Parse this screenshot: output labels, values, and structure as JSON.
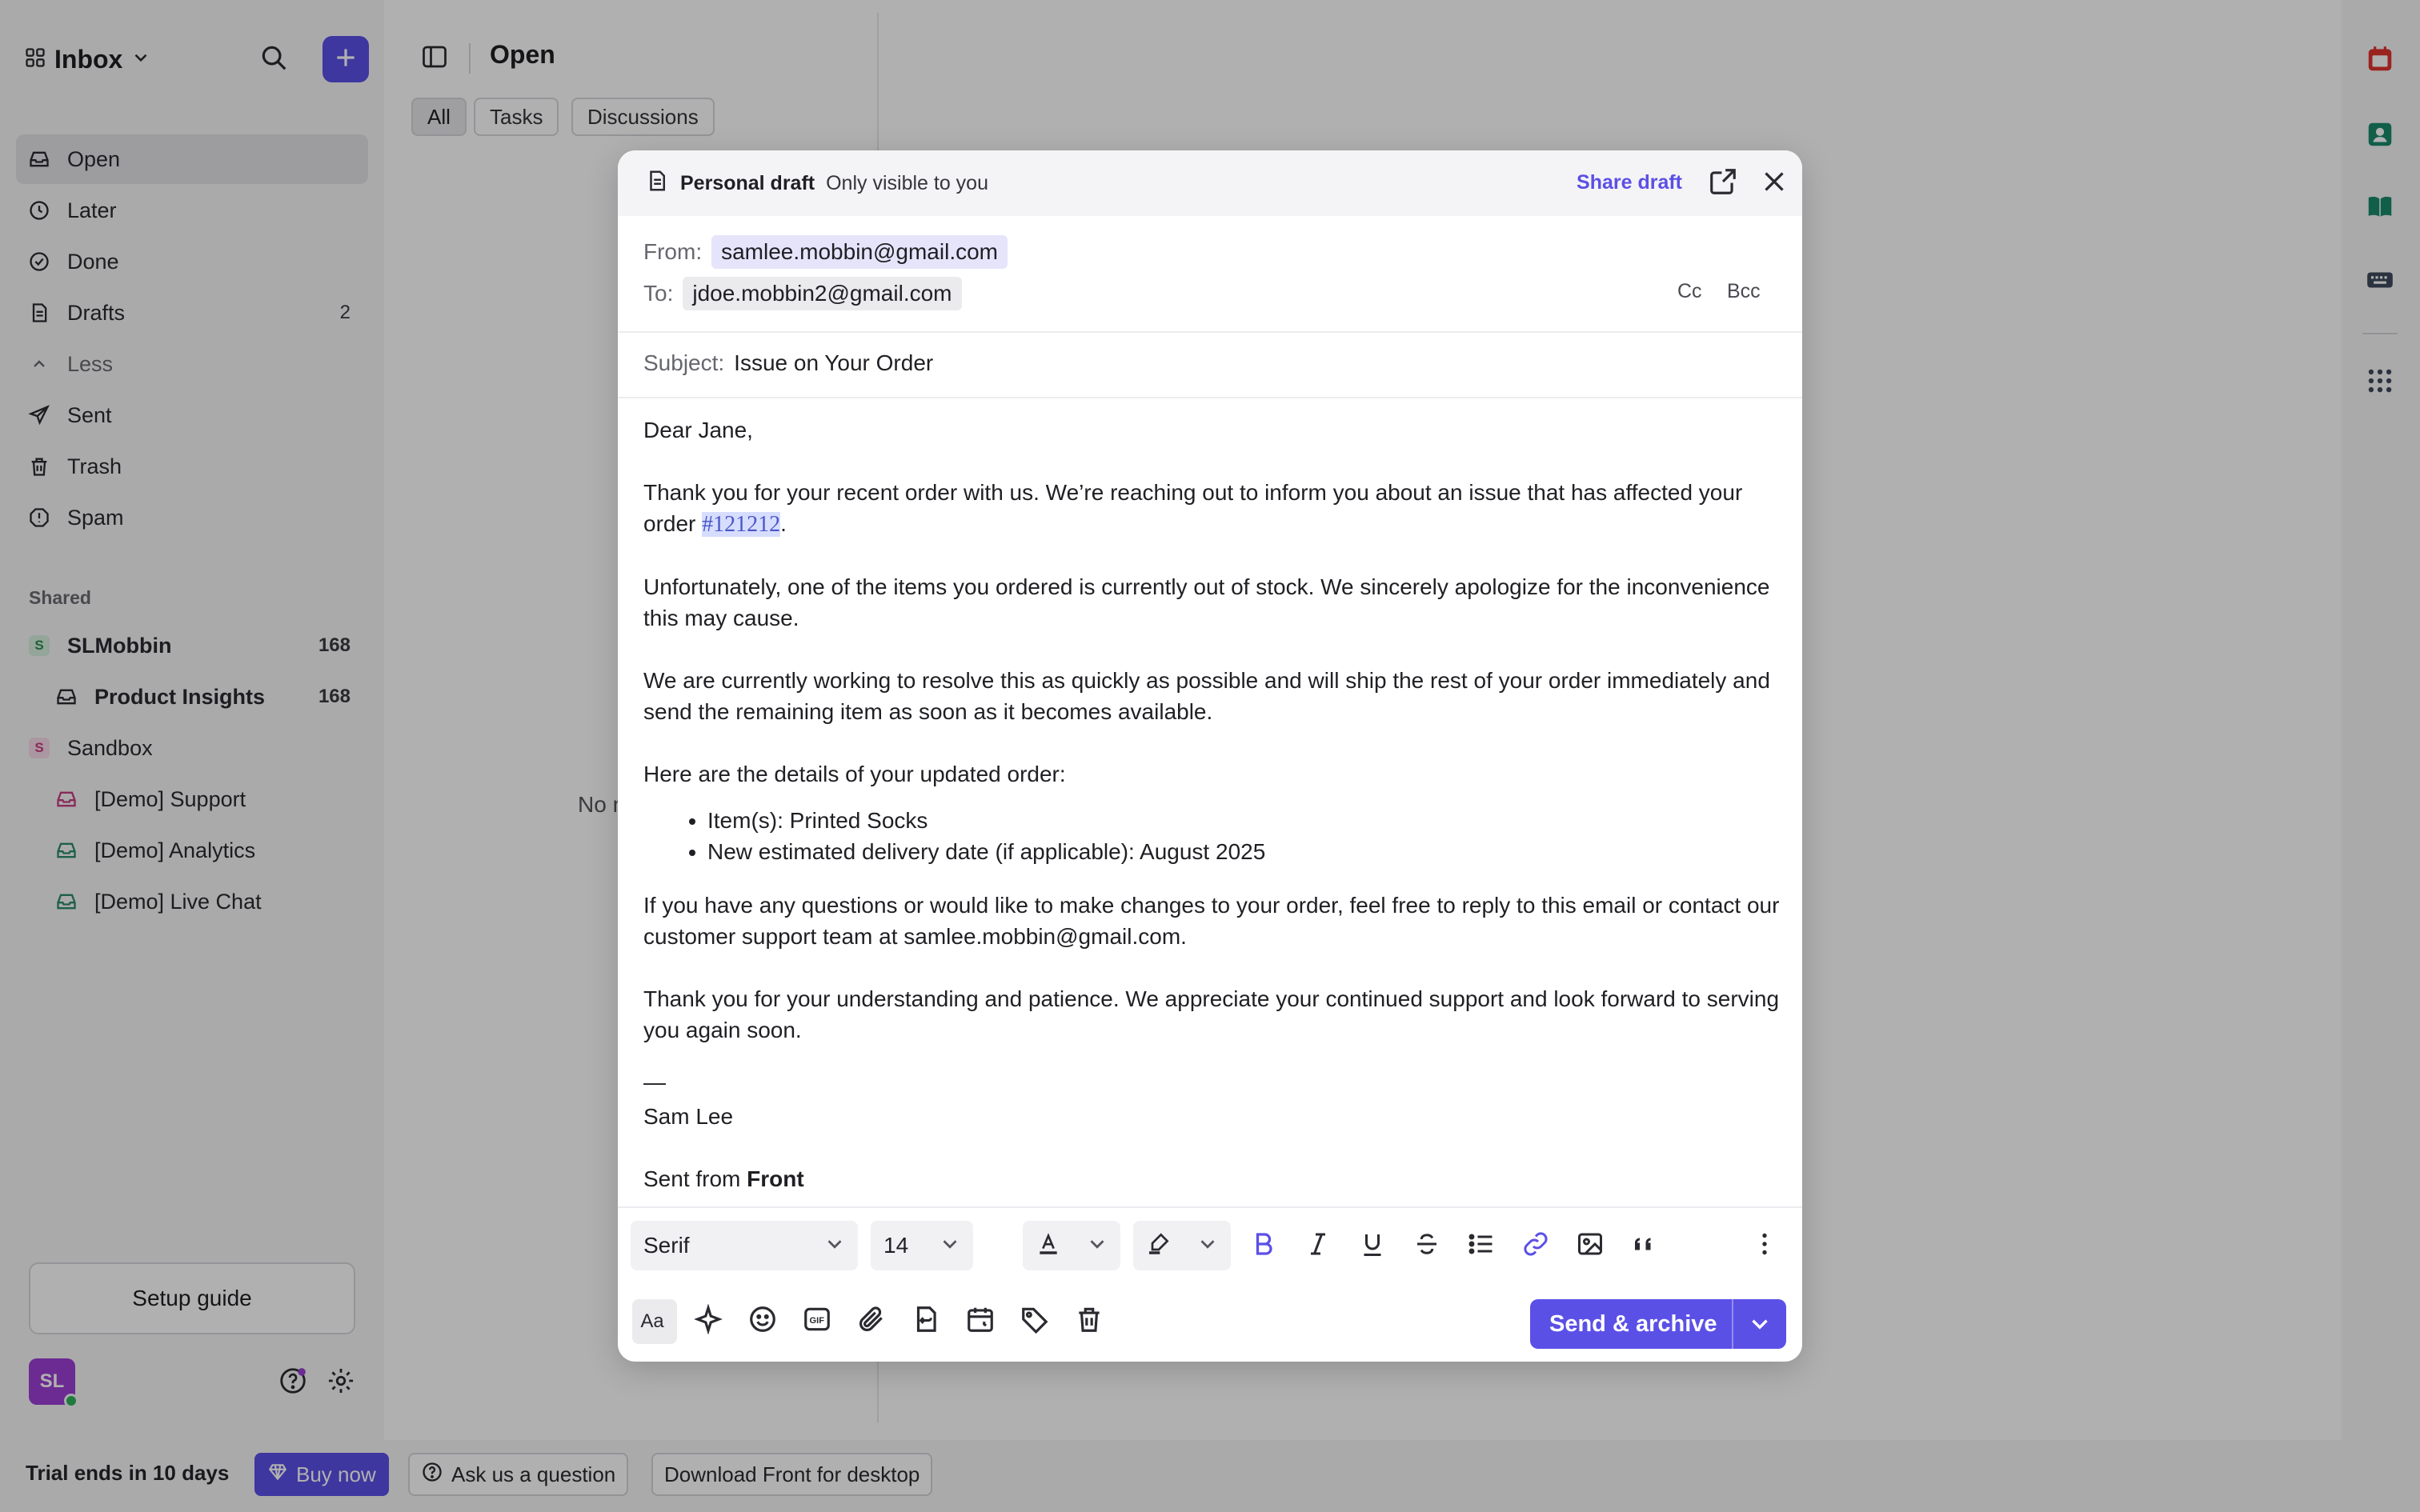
{
  "sidebar": {
    "inbox_title": "Inbox",
    "nav": [
      {
        "label": "Open",
        "icon": "inbox-icon",
        "active": true
      },
      {
        "label": "Later",
        "icon": "clock-icon"
      },
      {
        "label": "Done",
        "icon": "check-circle-icon"
      },
      {
        "label": "Drafts",
        "icon": "draft-icon",
        "count": "2"
      },
      {
        "label": "Less",
        "icon": "chevron-up-icon"
      },
      {
        "label": "Sent",
        "icon": "send-icon"
      },
      {
        "label": "Trash",
        "icon": "trash-icon"
      },
      {
        "label": "Spam",
        "icon": "spam-icon"
      }
    ],
    "shared_label": "Shared",
    "teams": [
      {
        "badge": "S",
        "label": "SLMobbin",
        "count": "168",
        "bold": true
      },
      {
        "label": "Product Insights",
        "count": "168",
        "bold": true,
        "sub": true
      },
      {
        "badge": "S",
        "label": "Sandbox"
      },
      {
        "label": "[Demo] Support",
        "sub": true
      },
      {
        "label": "[Demo] Analytics",
        "sub": true
      },
      {
        "label": "[Demo] Live Chat",
        "sub": true
      }
    ],
    "setup_guide": "Setup guide",
    "avatar_initials": "SL"
  },
  "main": {
    "title": "Open",
    "filters": [
      "All",
      "Tasks",
      "Discussions"
    ],
    "empty_text": "No m"
  },
  "compose": {
    "header_bold": "Personal draft",
    "header_muted": "Only visible to you",
    "share_draft": "Share draft",
    "from_label": "From:",
    "from_value": "samlee.mobbin@gmail.com",
    "to_label": "To:",
    "to_value": "jdoe.mobbin2@gmail.com",
    "cc": "Cc",
    "bcc": "Bcc",
    "subject_label": "Subject:",
    "subject_value": "Issue on Your Order",
    "greeting": "Dear Jane,",
    "p1_a": "Thank you for your recent order with us. We’re reaching out to inform you about an issue that has affected your order ",
    "p1_order": "#121212",
    "p1_b": ".",
    "p2": "Unfortunately, one of the items you ordered is currently out of stock. We sincerely apologize for the inconvenience this may cause.",
    "p3": "We are currently working to resolve this as quickly as possible and will ship the rest of your order immediately and send the remaining item as soon as it becomes available.",
    "p4": "Here are the details of your updated order:",
    "list": [
      "Item(s): Printed Socks",
      "New estimated delivery date (if applicable): August 2025"
    ],
    "p5": "If you have any questions or would like to make changes to your order, feel free to reply to this email or contact our customer support team at samlee.mobbin@gmail.com.",
    "p6": "Thank you for your understanding and patience. We appreciate your continued support and look forward to serving you again soon.",
    "dash": "—",
    "signature": "Sam Lee",
    "sent_from": "Sent from ",
    "sent_from_brand": "Front",
    "font_value": "Serif",
    "size_value": "14",
    "send_label": "Send & archive"
  },
  "bottom": {
    "trial": "Trial ends in 10 days",
    "buy_now": "Buy now",
    "ask": "Ask us a question",
    "download": "Download Front for desktop"
  },
  "colors": {
    "accent": "#5b50e6",
    "overlay": "rgba(0,0,0,0.31)"
  }
}
